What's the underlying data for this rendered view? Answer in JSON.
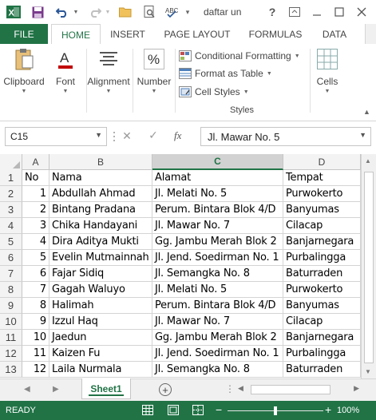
{
  "window": {
    "title": "daftar un",
    "accent": "#217346"
  },
  "ribbon": {
    "tabs": [
      "FILE",
      "HOME",
      "INSERT",
      "PAGE LAYOUT",
      "FORMULAS",
      "DATA"
    ],
    "active_tab": "HOME",
    "groups": {
      "clipboard": "Clipboard",
      "font": "Font",
      "alignment": "Alignment",
      "number": "Number",
      "cells": "Cells"
    },
    "styles": {
      "conditional_formatting": "Conditional Formatting",
      "format_as_table": "Format as Table",
      "cell_styles": "Cell Styles",
      "group_label": "Styles"
    }
  },
  "formula_bar": {
    "name_box": "C15",
    "fx_label": "fx",
    "content": "Jl. Mawar No. 5"
  },
  "grid": {
    "columns": [
      "A",
      "B",
      "C",
      "D"
    ],
    "selected_column": "C",
    "rows": [
      {
        "num": "1",
        "cells": [
          "No",
          "Nama",
          "Alamat",
          "Tempat"
        ]
      },
      {
        "num": "2",
        "cells": [
          "1",
          "Abdullah Ahmad",
          "Jl. Melati No. 5",
          "Purwokerto"
        ]
      },
      {
        "num": "3",
        "cells": [
          "2",
          "Bintang Pradana",
          "Perum. Bintara Blok 4/D",
          "Banyumas"
        ]
      },
      {
        "num": "4",
        "cells": [
          "3",
          "Chika Handayani",
          "Jl. Mawar No. 7",
          "Cilacap"
        ]
      },
      {
        "num": "5",
        "cells": [
          "4",
          "Dira Aditya Mukti",
          "Gg. Jambu Merah Blok 2",
          "Banjarnegara"
        ]
      },
      {
        "num": "6",
        "cells": [
          "5",
          "Evelin Mutmainnah",
          "Jl. Jend. Soedirman No. 1",
          "Purbalingga"
        ]
      },
      {
        "num": "7",
        "cells": [
          "6",
          "Fajar Sidiq",
          "Jl. Semangka No. 8",
          "Baturraden"
        ]
      },
      {
        "num": "8",
        "cells": [
          "7",
          "Gagah Waluyo",
          "Jl. Melati No. 5",
          "Purwokerto"
        ]
      },
      {
        "num": "9",
        "cells": [
          "8",
          "Halimah",
          "Perum. Bintara Blok 4/D",
          "Banyumas"
        ]
      },
      {
        "num": "10",
        "cells": [
          "9",
          "Izzul Haq",
          "Jl. Mawar No. 7",
          "Cilacap"
        ]
      },
      {
        "num": "11",
        "cells": [
          "10",
          "Jaedun",
          "Gg. Jambu Merah Blok 2",
          "Banjarnegara"
        ]
      },
      {
        "num": "12",
        "cells": [
          "11",
          "Kaizen Fu",
          "Jl. Jend. Soedirman No. 1",
          "Purbalingga"
        ]
      },
      {
        "num": "13",
        "cells": [
          "12",
          "Laila Nurmala",
          "Jl. Semangka No. 8",
          "Baturraden"
        ]
      }
    ]
  },
  "sheets": {
    "active": "Sheet1"
  },
  "status": {
    "text": "READY",
    "zoom": "100%"
  }
}
